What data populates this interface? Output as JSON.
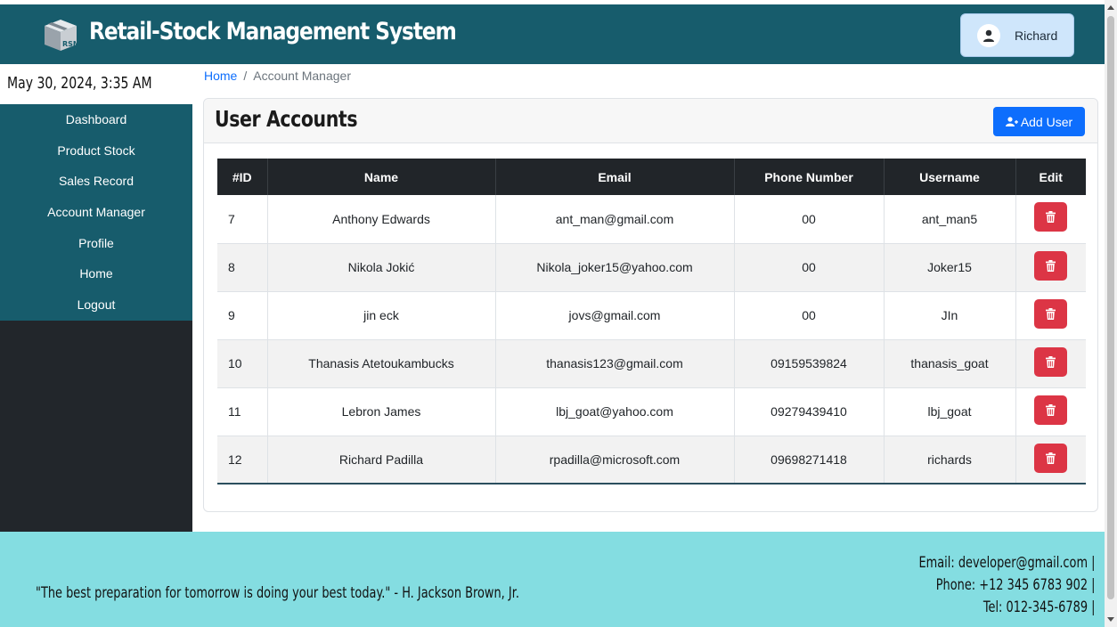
{
  "header": {
    "app_title": "Retail-Stock Management System",
    "logo_text": "RSMS",
    "user_name": "Richard"
  },
  "sidebar": {
    "datetime": "May 30, 2024, 3:35 AM",
    "items": [
      {
        "label": "Dashboard"
      },
      {
        "label": "Product Stock"
      },
      {
        "label": "Sales Record"
      },
      {
        "label": "Account Manager"
      },
      {
        "label": "Profile"
      },
      {
        "label": "Home"
      },
      {
        "label": "Logout"
      }
    ]
  },
  "breadcrumb": {
    "home": "Home",
    "separator": "/",
    "current": "Account Manager"
  },
  "card": {
    "title": "User Accounts",
    "add_button": "Add User"
  },
  "table": {
    "headers": [
      "#ID",
      "Name",
      "Email",
      "Phone Number",
      "Username",
      "Edit"
    ],
    "rows": [
      {
        "id": "7",
        "name": "Anthony Edwards",
        "email": "ant_man@gmail.com",
        "phone": "00",
        "username": "ant_man5"
      },
      {
        "id": "8",
        "name": "Nikola Jokić",
        "email": "Nikola_joker15@yahoo.com",
        "phone": "00",
        "username": "Joker15"
      },
      {
        "id": "9",
        "name": "jin eck",
        "email": "jovs@gmail.com",
        "phone": "00",
        "username": "JIn"
      },
      {
        "id": "10",
        "name": "Thanasis Atetoukambucks",
        "email": "thanasis123@gmail.com",
        "phone": "09159539824",
        "username": "thanasis_goat"
      },
      {
        "id": "11",
        "name": "Lebron James",
        "email": "lbj_goat@yahoo.com",
        "phone": "09279439410",
        "username": "lbj_goat"
      },
      {
        "id": "12",
        "name": "Richard Padilla",
        "email": "rpadilla@microsoft.com",
        "phone": "09698271418",
        "username": "richards"
      }
    ]
  },
  "footer": {
    "quote": "\"The best preparation for tomorrow is doing your best today.\" - H. Jackson Brown, Jr.",
    "email": "Email: developer@gmail.com |",
    "phone": "Phone: +12 345 6783 902 |",
    "tel": "Tel: 012-345-6789 |"
  },
  "colors": {
    "header_bg": "#175c6c",
    "sidebar_bg": "#22262b",
    "footer_bg": "#84dde1",
    "primary": "#0d6efd",
    "danger": "#dc3545"
  },
  "icons": {
    "user": "user-circle-icon",
    "add_user": "user-plus-icon",
    "delete": "trash-icon",
    "logo": "box-icon"
  }
}
